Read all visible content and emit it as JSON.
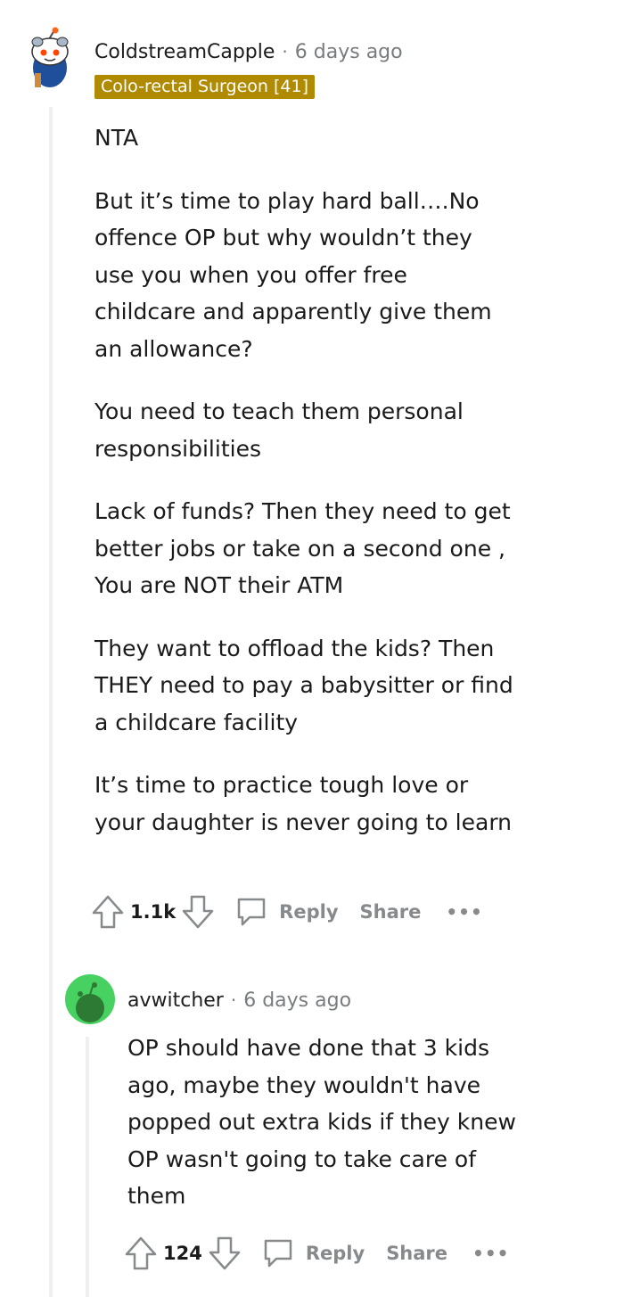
{
  "comments": [
    {
      "username": "ColdstreamCapple",
      "separator": "·",
      "timestamp": "6 days ago",
      "flair": "Colo-rectal Surgeon [41]",
      "flair_color": "#b08a00",
      "avatar_icon": "snoo-avatar-icon",
      "paragraphs": [
        "NTA",
        "But it’s time to play hard ball….No offence OP but why wouldn’t they use you when you offer free childcare and apparently give them an allowance?",
        "You need to teach them personal responsibilities",
        "Lack of funds? Then they need to get better jobs or take on a second one , You are NOT their ATM",
        "They want to offload the kids? Then THEY need to pay a babysitter or find a childcare facility",
        "It’s time to practice tough love or your daughter is never going to learn"
      ],
      "upvote_icon": "upvote-arrow-icon",
      "score": "1.1k",
      "downvote_icon": "downvote-arrow-icon",
      "reply_icon": "speech-bubble-icon",
      "reply_label": "Reply",
      "share_label": "Share",
      "more_label": "•••"
    },
    {
      "username": "avwitcher",
      "separator": "·",
      "timestamp": "6 days ago",
      "avatar_icon": "default-snoo-avatar-icon",
      "avatar_color": "#46d160",
      "paragraphs": [
        "OP should have done that 3 kids ago, maybe they wouldn't have popped out extra kids if they knew OP wasn't going to take care of them"
      ],
      "upvote_icon": "upvote-arrow-icon",
      "score": "124",
      "downvote_icon": "downvote-arrow-icon",
      "reply_icon": "speech-bubble-icon",
      "reply_label": "Reply",
      "share_label": "Share",
      "more_label": "•••"
    }
  ],
  "colors": {
    "thread_line": "#edeff1",
    "muted_text": "#878a8c",
    "timestamp": "#787c7e"
  }
}
